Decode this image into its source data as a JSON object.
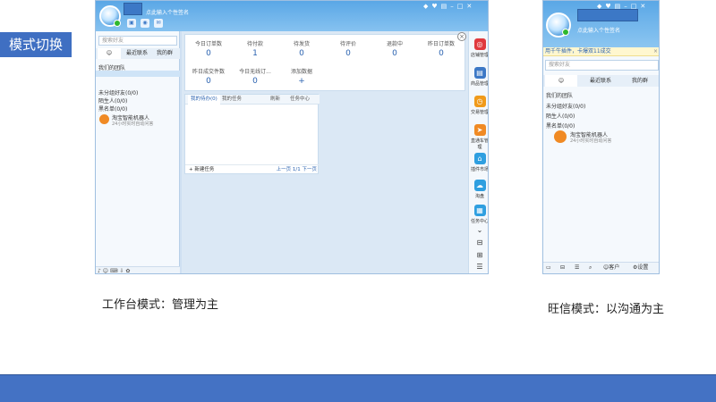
{
  "slide": {
    "title": "模式切换",
    "caption_left": "工作台模式：管理为主",
    "caption_right": "旺信模式：以沟通为主"
  },
  "colors": {
    "title_bg": "#3f6fc2",
    "footer": "#4472c4",
    "window_top": "#5aa7e6",
    "accent": "#2a62b0"
  },
  "workbench": {
    "signature": "点此输入个性签名",
    "mini_icons": [
      "chat-icon",
      "globe-icon",
      "mail-icon"
    ],
    "window_controls": [
      "pin-icon",
      "skin-icon",
      "menu-icon",
      "minimize-icon",
      "maximize-icon",
      "close-icon"
    ],
    "search_placeholder": "搜索好友",
    "tabs": [
      "",
      "最近联系",
      "我的群"
    ],
    "tree": [
      "我们的团队",
      "未分组好友(0/0)",
      "陌生人(0/0)",
      "黑名单(0/0)"
    ],
    "bot": {
      "name": "淘宝智能机器人",
      "sub": "24小时实时自动问答"
    },
    "stats_row1": {
      "labels": [
        "今日订单数",
        "待付款",
        "待发货",
        "待评价",
        "退款中",
        "昨日订单数"
      ],
      "values": [
        "0",
        "1",
        "0",
        "0",
        "0",
        "0"
      ]
    },
    "stats_row2": {
      "labels": [
        "昨日成交件数",
        "今日无线订...",
        "添加数据"
      ],
      "values": [
        "0",
        "0",
        "+"
      ]
    },
    "tasks": {
      "tabs": [
        "我的待办(0)",
        "我的任务",
        "刷新",
        "任务中心"
      ],
      "new_task": "+ 新建任务",
      "pager": "上一页 1/1 下一页"
    },
    "tools": [
      {
        "label": "店铺管理",
        "color": "#e0393e",
        "glyph": "◎"
      },
      {
        "label": "商品管理",
        "color": "#3c78c6",
        "glyph": "▤"
      },
      {
        "label": "交易管理",
        "color": "#f09a1a",
        "glyph": "◷"
      },
      {
        "label": "直通车管理",
        "color": "#f08a24",
        "glyph": "➤"
      },
      {
        "label": "插件市场",
        "color": "#2f9fe0",
        "glyph": "⌂"
      },
      {
        "label": "淘盘",
        "color": "#2f9fe0",
        "glyph": "☁"
      },
      {
        "label": "任务中心",
        "color": "#2f9fe0",
        "glyph": "▦"
      }
    ],
    "bottom_icons": "♪ ☺ ⌨ ⇩ ✿"
  },
  "wangxin": {
    "signature": "点此输入个性签名",
    "notice": "用千牛插件，卡爆双11成交",
    "search_placeholder": "搜索好友",
    "tabs": [
      "",
      "最近联系",
      "我的群"
    ],
    "tree": [
      "我们的团队",
      "未分组好友(0/0)",
      "陌生人(0/0)",
      "黑名单(0/0)"
    ],
    "bot": {
      "name": "淘宝智能机器人",
      "sub": "24小时实时自动问答"
    },
    "bottom": {
      "kf": "客户",
      "settings": "设置"
    }
  }
}
